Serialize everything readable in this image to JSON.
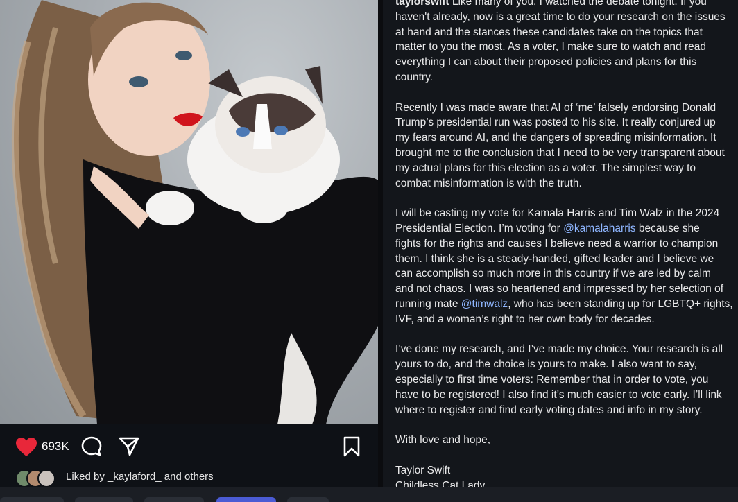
{
  "post": {
    "like_count": "693K",
    "liked_by_prefix": "Liked by ",
    "liked_by_user": "_kaylaford_",
    "liked_by_suffix": " and others"
  },
  "caption": {
    "lines_p1": [
      {
        "pre_bold": "taylorswift",
        "text": " Like many of you, I watched the debate tonight. If you"
      },
      {
        "text": "haven't already, now is a great time to do your research on the issues"
      },
      {
        "text": "at hand and the stances these candidates take on the topics that"
      },
      {
        "text": "matter to you the most. As a voter, I make sure to watch and read"
      },
      {
        "text": "everything I can about their proposed policies and plans for this"
      },
      {
        "text": "country."
      }
    ],
    "lines_p2": [
      "Recently I was made aware that AI of ‘me’ falsely endorsing Donald",
      "Trump’s presidential run was posted to his site. It really conjured up",
      "my fears around AI, and the dangers of spreading misinformation. It",
      "brought me to the conclusion that I need to be very transparent about",
      "my actual plans for this election as a voter. The simplest way to",
      "combat misinformation is with the truth."
    ],
    "p3_line1": "I will be casting my vote for Kamala Harris and Tim Walz in the 2024",
    "p3_line2_pre": "Presidential Election. I’m voting for ",
    "p3_mention1": "@kamalaharris",
    "p3_line2_post": " because she",
    "p3_line3": "fights for the rights and causes I believe need a warrior to champion",
    "p3_line4": "them. I think she is a steady-handed, gifted leader and I believe we",
    "p3_line5": "can accomplish so much more in this country if we are led by calm",
    "p3_line6": "and not chaos. I was so heartened and impressed by her selection of",
    "p3_line7_pre": "running mate ",
    "p3_mention2": "@timwalz",
    "p3_line7_post": ", who has been standing up for LGBTQ+ rights,",
    "p3_line8": "IVF, and a woman’s right to her own body for decades.",
    "lines_p4": [
      "I’ve done my research, and I’ve made my choice. Your research is all",
      "yours to do, and the choice is yours to make. I also want to say,",
      "especially to first time voters: Remember that in order to vote, you",
      "have to be registered! I also find it’s much easier to vote early. I’ll link",
      "where to register and find early voting dates and info in my story."
    ],
    "p5": "With love and hope,",
    "sign1": "Taylor Swift",
    "sign2": "Childless Cat Lady"
  },
  "colors": {
    "like": "#e8273a",
    "mention": "#8fb6ff",
    "active_tab": "#4b5bd4"
  },
  "icons": [
    "heart-icon",
    "comment-icon",
    "share-icon",
    "bookmark-icon"
  ]
}
